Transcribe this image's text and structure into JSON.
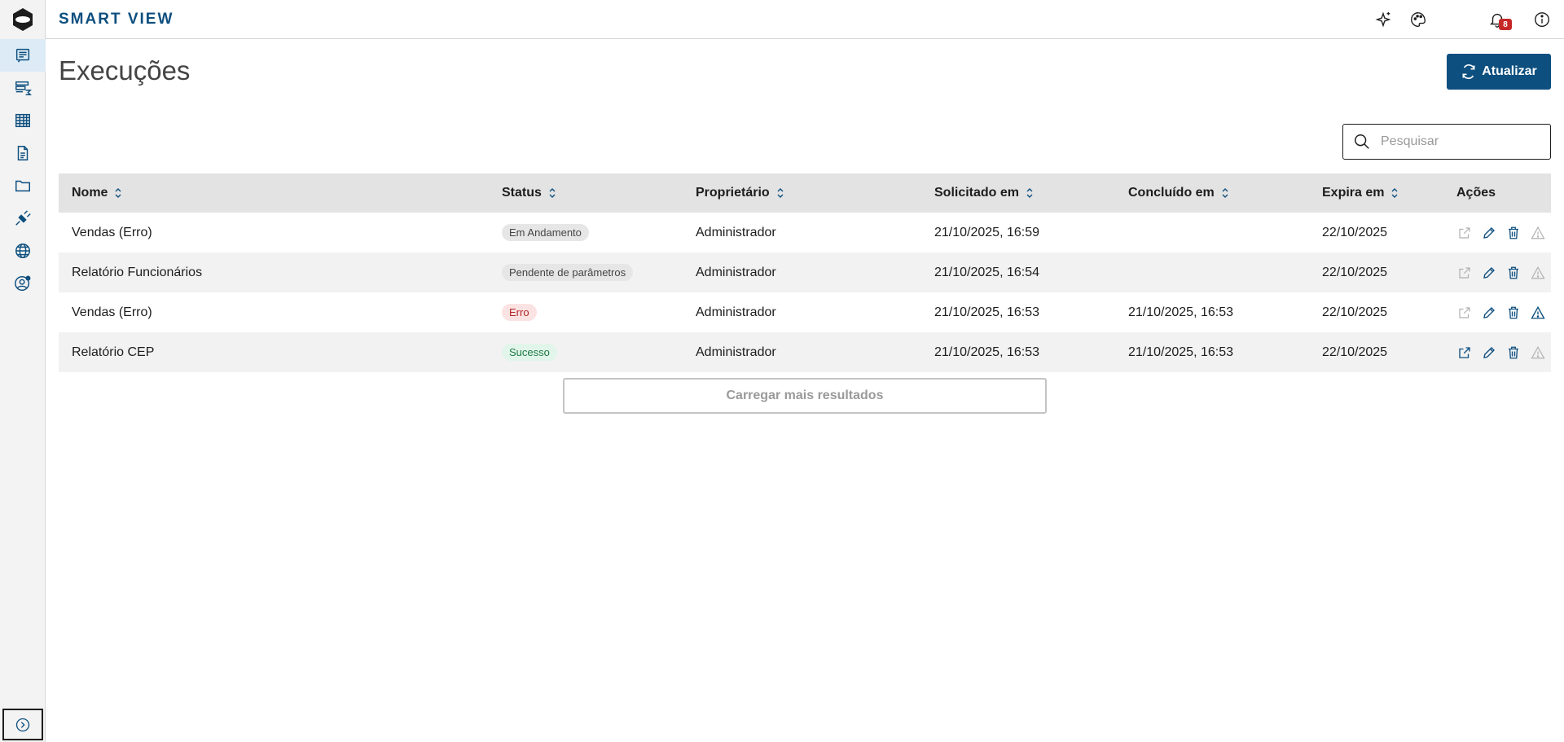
{
  "app": {
    "title": "SMART VIEW"
  },
  "header": {
    "notifications_count": "8",
    "icons": [
      "sparkles-icon",
      "palette-icon",
      "bell-icon",
      "info-icon",
      "user-icon"
    ]
  },
  "sidebar": {
    "items": [
      {
        "name": "executions",
        "icon": "report-list-icon",
        "active": true
      },
      {
        "name": "reports-sum",
        "icon": "table-sum-icon",
        "active": false
      },
      {
        "name": "grid",
        "icon": "grid-icon",
        "active": false
      },
      {
        "name": "documents",
        "icon": "document-icon",
        "active": false
      },
      {
        "name": "folders",
        "icon": "folder-icon",
        "active": false
      },
      {
        "name": "connections",
        "icon": "plug-icon",
        "active": false
      },
      {
        "name": "web",
        "icon": "globe-icon",
        "active": false
      },
      {
        "name": "user-settings",
        "icon": "user-gear-icon",
        "active": false
      }
    ],
    "expand_icon": "chevron-right-circle-icon"
  },
  "main": {
    "title": "Execuções",
    "refresh_label": "Atualizar",
    "search_placeholder": "Pesquisar",
    "load_more_label": "Carregar mais resultados"
  },
  "table": {
    "columns": {
      "nome": "Nome",
      "status": "Status",
      "proprietario": "Proprietário",
      "solicitado": "Solicitado em",
      "concluido": "Concluído em",
      "expira": "Expira em",
      "acoes": "Ações"
    },
    "rows": [
      {
        "nome": "Vendas (Erro)",
        "status": "Em Andamento",
        "status_type": "andamento",
        "proprietario": "Administrador",
        "solicitado": "21/10/2025, 16:59",
        "concluido": "",
        "expira": "22/10/2025"
      },
      {
        "nome": "Relatório Funcionários",
        "status": "Pendente de parâmetros",
        "status_type": "pendente",
        "proprietario": "Administrador",
        "solicitado": "21/10/2025, 16:54",
        "concluido": "",
        "expira": "22/10/2025"
      },
      {
        "nome": "Vendas (Erro)",
        "status": "Erro",
        "status_type": "erro",
        "proprietario": "Administrador",
        "solicitado": "21/10/2025, 16:53",
        "concluido": "21/10/2025, 16:53",
        "expira": "22/10/2025"
      },
      {
        "nome": "Relatório CEP",
        "status": "Sucesso",
        "status_type": "sucesso",
        "proprietario": "Administrador",
        "solicitado": "21/10/2025, 16:53",
        "concluido": "21/10/2025, 16:53",
        "expira": "22/10/2025"
      }
    ]
  },
  "colors": {
    "brand": "#0d4f7f",
    "badge": "#c62828",
    "error": "#b32626",
    "success": "#1e7a45"
  }
}
